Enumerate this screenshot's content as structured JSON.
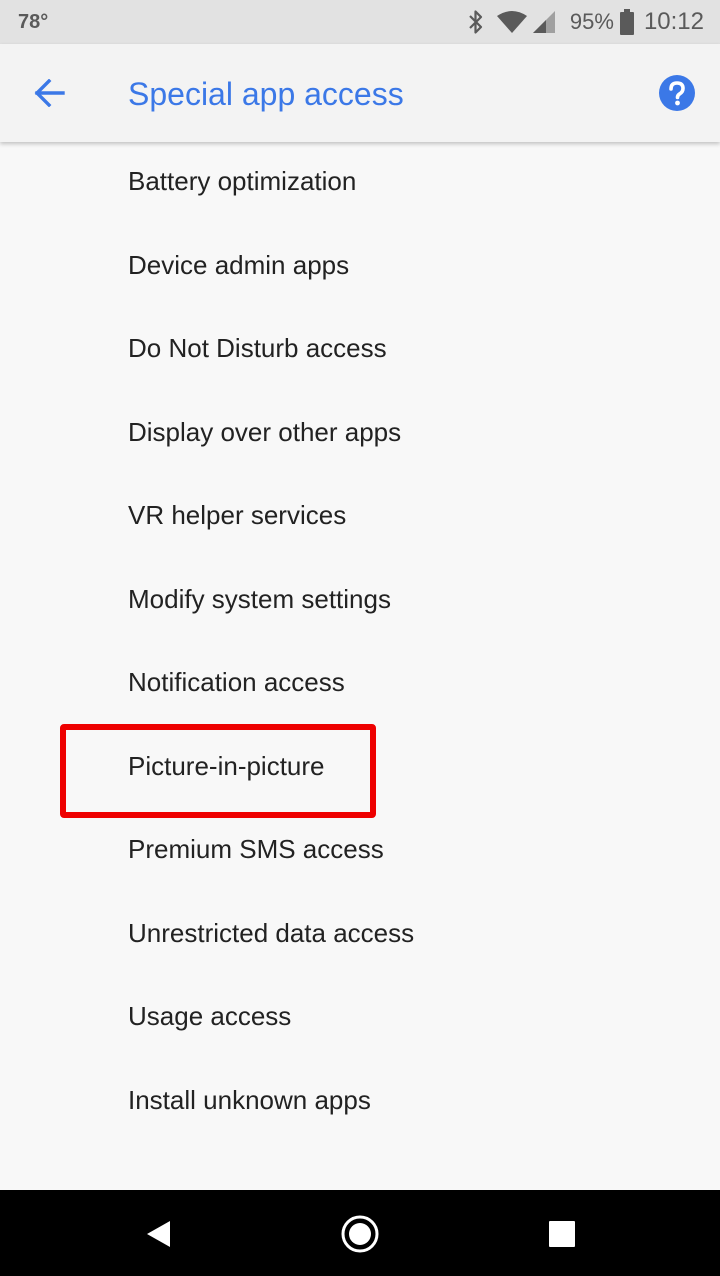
{
  "status_bar": {
    "temperature": "78°",
    "battery_percent": "95%",
    "time": "10:12",
    "icons": [
      "bluetooth-icon",
      "wifi-icon",
      "cell-signal-icon",
      "battery-icon"
    ]
  },
  "app_bar": {
    "title": "Special app access",
    "back_icon": "back-arrow-icon",
    "help_icon": "help-icon"
  },
  "settings_list": {
    "items": [
      {
        "label": "Battery optimization"
      },
      {
        "label": "Device admin apps"
      },
      {
        "label": "Do Not Disturb access"
      },
      {
        "label": "Display over other apps"
      },
      {
        "label": "VR helper services"
      },
      {
        "label": "Modify system settings"
      },
      {
        "label": "Notification access"
      },
      {
        "label": "Picture-in-picture"
      },
      {
        "label": "Premium SMS access"
      },
      {
        "label": "Unrestricted data access"
      },
      {
        "label": "Usage access"
      },
      {
        "label": "Install unknown apps"
      }
    ],
    "highlighted_item": "Picture-in-picture"
  },
  "nav_bar": {
    "icons": [
      "nav-back-icon",
      "nav-home-icon",
      "nav-recents-icon"
    ]
  },
  "colors": {
    "accent": "#3b78e7",
    "highlight_border": "#ee0000",
    "background": "#f8f8f8",
    "status_bar": "#e2e2e2",
    "nav_bar": "#000000"
  }
}
